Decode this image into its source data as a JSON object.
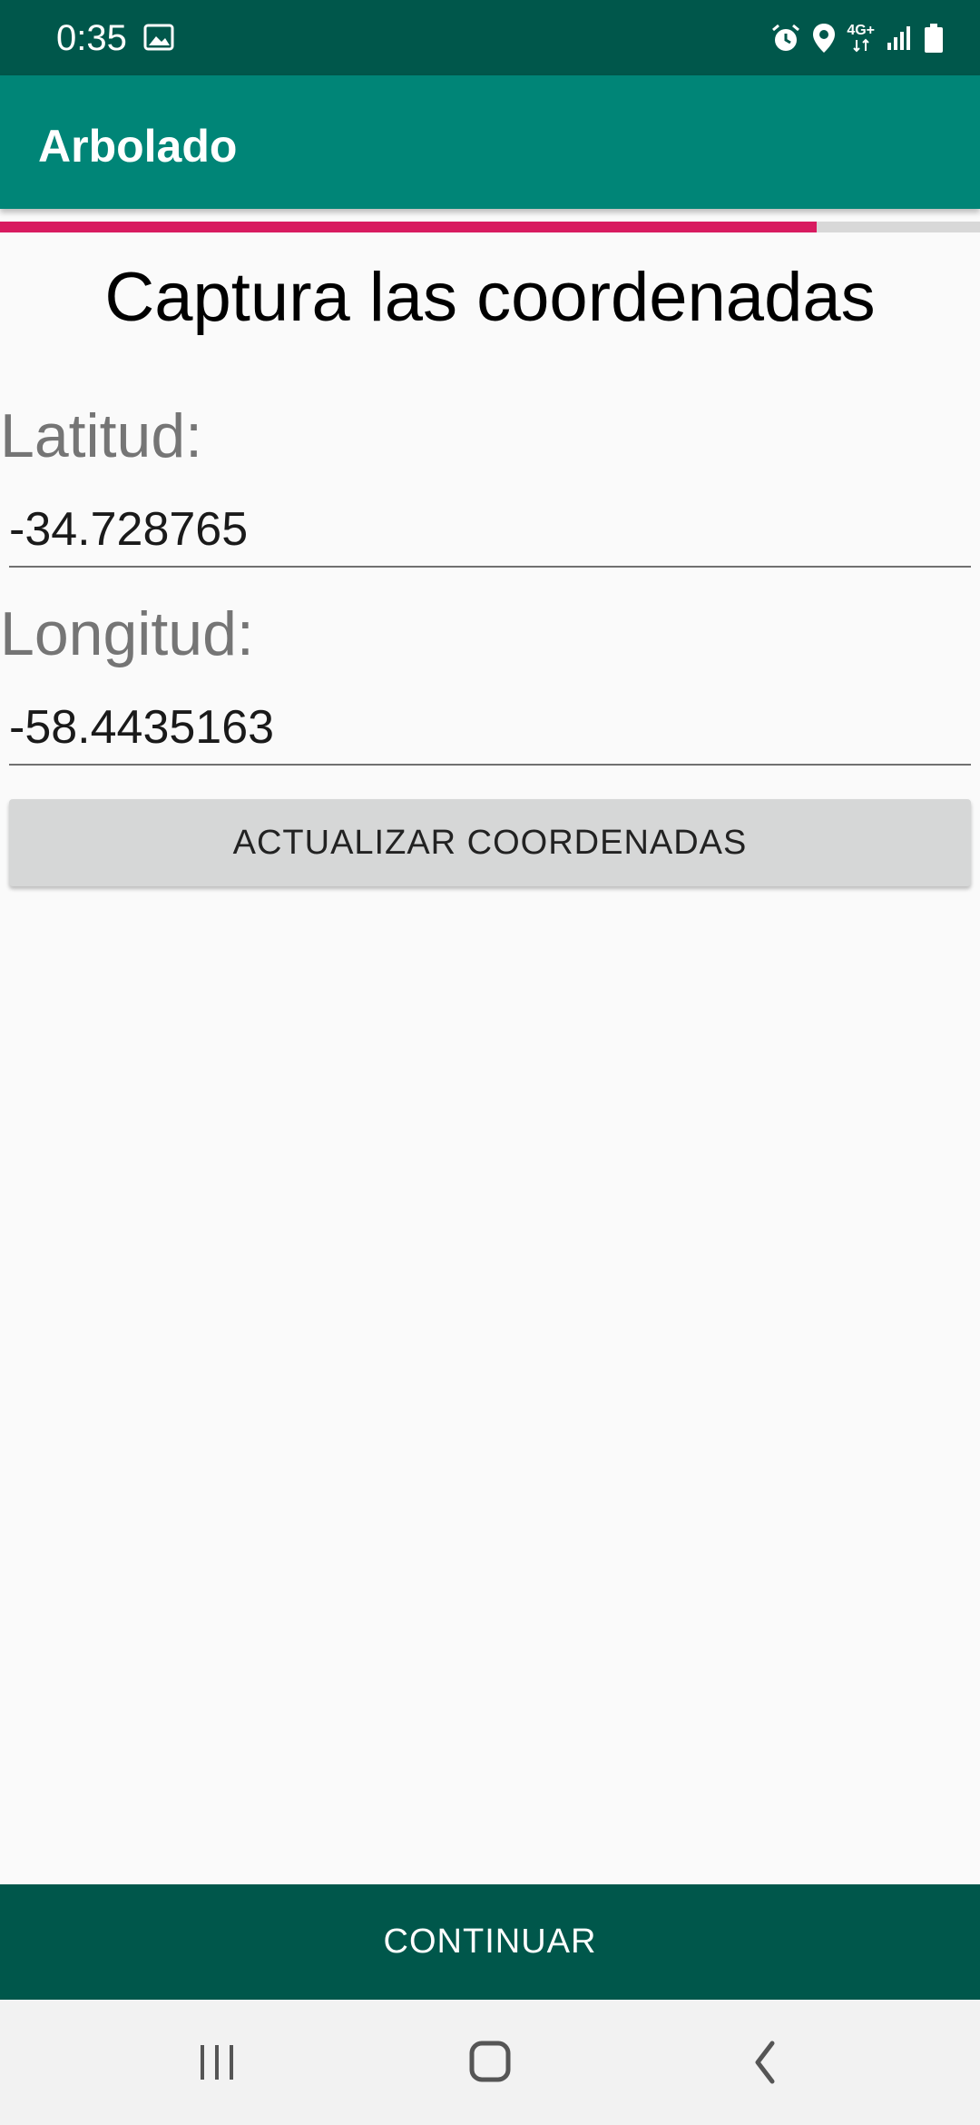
{
  "status_bar": {
    "time": "0:35",
    "network": "4G+",
    "icons": [
      "image-icon",
      "alarm-icon",
      "location-icon",
      "network-4g-icon",
      "signal-icon",
      "battery-icon"
    ]
  },
  "app_bar": {
    "title": "Arbolado"
  },
  "progress": {
    "fraction": 0.833,
    "color": "#d81b60"
  },
  "main": {
    "title": "Captura las coordenadas",
    "latitude": {
      "label": "Latitud:",
      "value": "-34.728765"
    },
    "longitude": {
      "label": "Longitud:",
      "value": "-58.4435163"
    },
    "update_button_label": "ACTUALIZAR COORDENADAS"
  },
  "footer": {
    "continue_label": "CONTINUAR"
  },
  "nav_bar": {
    "icons": [
      "recent-apps-icon",
      "home-icon",
      "back-icon"
    ]
  },
  "colors": {
    "primary": "#008577",
    "primary_dark": "#00574b",
    "accent": "#d81b60"
  }
}
